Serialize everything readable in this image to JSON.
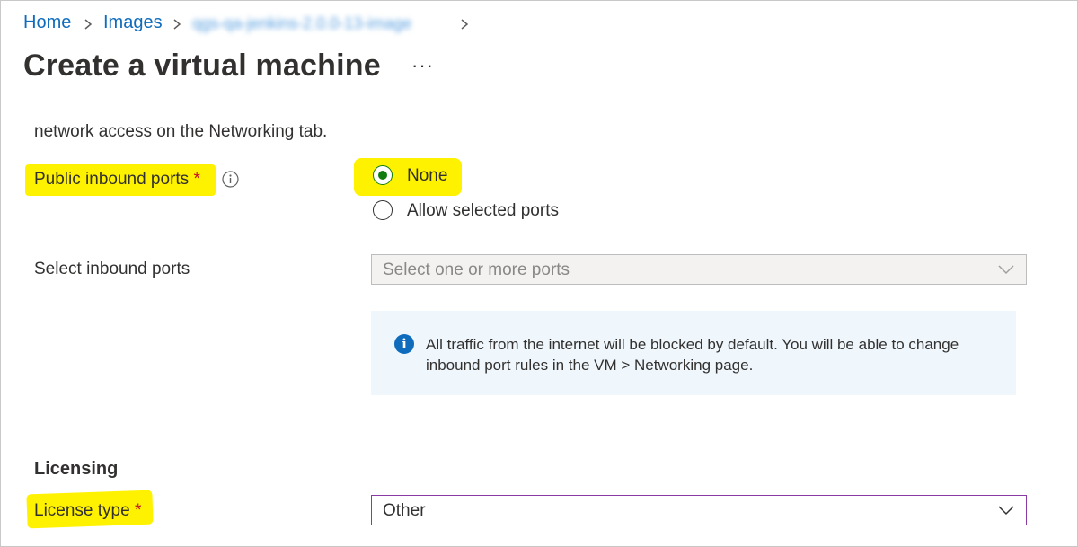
{
  "breadcrumb": {
    "items": [
      "Home",
      "Images"
    ],
    "current_blurred": "qgs-qa-jenkins-2.0.0-13-image"
  },
  "page": {
    "title": "Create a virtual machine",
    "more": "···"
  },
  "networking": {
    "intro_text": "network access on the Networking tab.",
    "public_inbound_ports": {
      "label": "Public inbound ports",
      "required_mark": "*",
      "info_icon": "info-icon",
      "options": [
        "None",
        "Allow selected ports"
      ],
      "selected": "None"
    },
    "select_inbound_ports": {
      "label": "Select inbound ports",
      "placeholder": "Select one or more ports"
    },
    "info_message": "All traffic from the internet will be blocked by default. You will be able to change inbound port rules in the VM > Networking page."
  },
  "licensing": {
    "heading": "Licensing",
    "license_type": {
      "label": "License type",
      "required_mark": "*",
      "value": "Other"
    }
  },
  "colors": {
    "link": "#0f6cbd",
    "highlight": "#fff200",
    "required": "#c50f1f",
    "radio_selected": "#107c10",
    "info_bg": "#eff6fc"
  }
}
